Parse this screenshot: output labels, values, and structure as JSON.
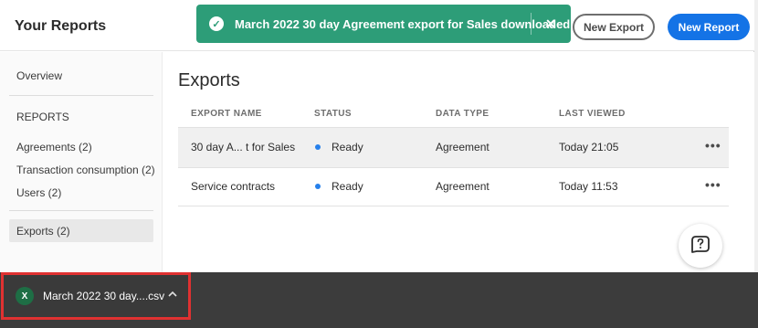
{
  "header": {
    "title": "Your Reports",
    "new_export_label": "New Export",
    "new_report_label": "New Report"
  },
  "toast": {
    "message": "March 2022 30 day Agreement export for Sales downloaded",
    "close_glyph": "✕",
    "check_glyph": "✓",
    "color": "#2d9d78"
  },
  "sidebar": {
    "overview": "Overview",
    "section_label": "REPORTS",
    "items": [
      {
        "label": "Agreements (2)"
      },
      {
        "label": "Transaction consumption (2)"
      },
      {
        "label": "Users (2)"
      }
    ],
    "exports": "Exports (2)"
  },
  "main": {
    "heading": "Exports",
    "columns": [
      "EXPORT NAME",
      "STATUS",
      "DATA TYPE",
      "LAST VIEWED"
    ],
    "rows": [
      {
        "name": "30 day A...  t for Sales",
        "status": "Ready",
        "type": "Agreement",
        "viewed": "Today 21:05",
        "more": "•••"
      },
      {
        "name": "Service contracts",
        "status": "Ready",
        "type": "Agreement",
        "viewed": "Today 11:53",
        "more": "•••"
      }
    ],
    "status_color": "#2680eb"
  },
  "help": {
    "glyph": "?"
  },
  "download": {
    "filename": "March 2022 30 day....csv",
    "icon_glyph": "X",
    "chevron": "^"
  },
  "colors": {
    "accent": "#1473e6",
    "highlight": "#e03131"
  }
}
